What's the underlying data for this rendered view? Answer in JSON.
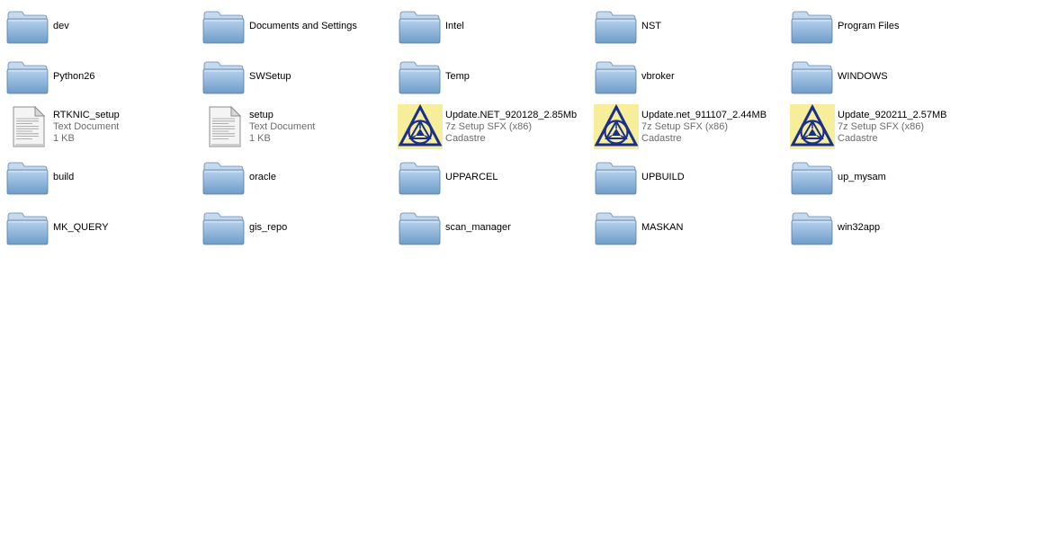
{
  "colors": {
    "folder_front": "#6e9cc8",
    "folder_back": "#a9c7e6",
    "sfx_background": "#f7ee9b",
    "sfx_triangle": "#1a2f8c",
    "secondary_text": "#6d6d6d"
  },
  "items": [
    {
      "kind": "folder",
      "icon": "folder-icon",
      "name": "dev"
    },
    {
      "kind": "folder",
      "icon": "folder-icon",
      "name": "Documents and Settings"
    },
    {
      "kind": "folder",
      "icon": "folder-icon",
      "name": "Intel"
    },
    {
      "kind": "folder",
      "icon": "folder-icon",
      "name": "NST"
    },
    {
      "kind": "folder",
      "icon": "folder-icon",
      "name": "Program Files"
    },
    {
      "kind": "folder",
      "icon": "folder-icon",
      "name": "Python26"
    },
    {
      "kind": "folder",
      "icon": "folder-icon",
      "name": "SWSetup"
    },
    {
      "kind": "folder",
      "icon": "folder-icon",
      "name": "Temp"
    },
    {
      "kind": "folder",
      "icon": "folder-icon",
      "name": "vbroker"
    },
    {
      "kind": "folder",
      "icon": "folder-icon",
      "name": "WINDOWS"
    },
    {
      "kind": "text",
      "icon": "text-document-icon",
      "name": "RTKNIC_setup",
      "type": "Text Document",
      "extra": "1 KB"
    },
    {
      "kind": "text",
      "icon": "text-document-icon",
      "name": "setup",
      "type": "Text Document",
      "extra": "1 KB"
    },
    {
      "kind": "sfx",
      "icon": "sfx-installer-icon",
      "name": "Update.NET_920128_2.85Mb",
      "type": "7z Setup SFX (x86)",
      "extra": "Cadastre"
    },
    {
      "kind": "sfx",
      "icon": "sfx-installer-icon",
      "name": "Update.net_911107_2.44MB",
      "type": "7z Setup SFX (x86)",
      "extra": "Cadastre"
    },
    {
      "kind": "sfx",
      "icon": "sfx-installer-icon",
      "name": "Update_920211_2.57MB",
      "type": "7z Setup SFX (x86)",
      "extra": "Cadastre"
    },
    {
      "kind": "folder",
      "icon": "folder-icon",
      "name": "build"
    },
    {
      "kind": "folder",
      "icon": "folder-icon",
      "name": "oracle"
    },
    {
      "kind": "folder",
      "icon": "folder-icon",
      "name": "UPPARCEL"
    },
    {
      "kind": "folder",
      "icon": "folder-icon",
      "name": "UPBUILD"
    },
    {
      "kind": "folder",
      "icon": "folder-icon",
      "name": "up_mysam"
    },
    {
      "kind": "folder",
      "icon": "folder-icon",
      "name": "MK_QUERY"
    },
    {
      "kind": "folder",
      "icon": "folder-icon",
      "name": "gis_repo"
    },
    {
      "kind": "folder",
      "icon": "folder-icon",
      "name": "scan_manager"
    },
    {
      "kind": "folder",
      "icon": "folder-icon",
      "name": "MASKAN"
    },
    {
      "kind": "folder",
      "icon": "folder-icon",
      "name": "win32app"
    }
  ]
}
